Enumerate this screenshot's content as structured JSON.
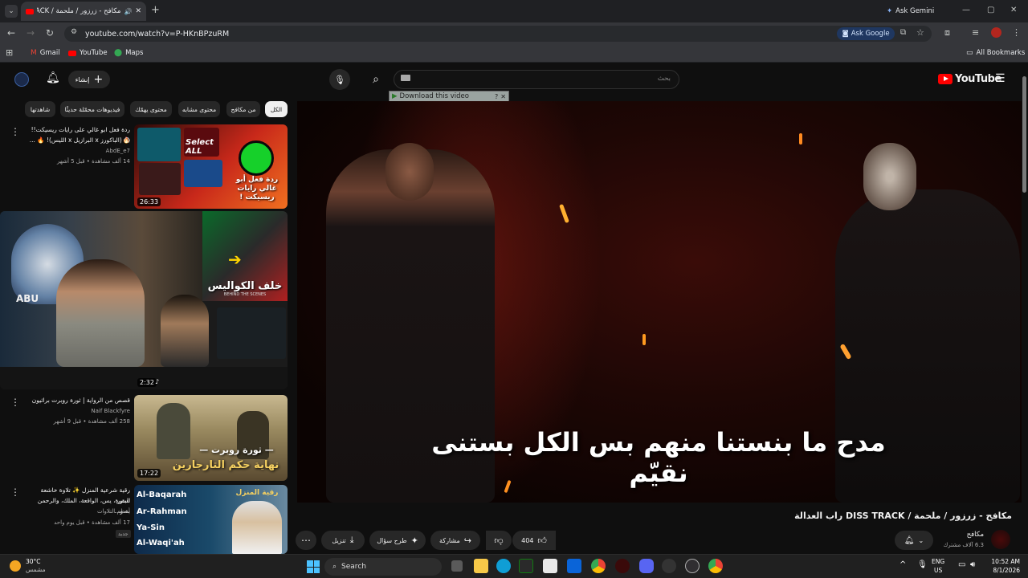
{
  "browser": {
    "tab_title": "مكافح - زرزور / ملحمة / DISS TRACK",
    "url": "youtube.com/watch?v=P-HKnBPzuRM",
    "ask_gemini": "Ask Gemini",
    "ask_google": "Ask Google",
    "bookmarks": [
      "Gmail",
      "YouTube",
      "Maps"
    ],
    "all_bookmarks": "All Bookmarks"
  },
  "youtube": {
    "logo_text": "YouTube",
    "search_placeholder": "بحث",
    "create_label": "إنشاء",
    "download_bar": "Download this video",
    "chips": [
      "الكل",
      "من مكافح",
      "محتوى مشابه",
      "محتوى يهمّك",
      "فيديوهات محمّلة حديثًا",
      "شاهدتها"
    ],
    "recommendations": [
      {
        "title_line1": "ردة فعل ابو غالي على رايات ريسيكت!! 🔥",
        "title_line2": "😱 (الباكورز x البرازيل x الليس)! 🔥 ...",
        "channel": "AbdE_e7",
        "meta": "14 ألف مشاهدة • قبل 5 أشهر",
        "duration": "26:33",
        "thumb_text": "ردة فعل أبو غالي رايات ريسيكت !",
        "select_text": "Select ALL"
      },
      {
        "duration": "2:32",
        "thumb_text": "خلف الكواليس",
        "thumb_sub": "BEHIND THE SCENES",
        "logo_text": "ABU"
      },
      {
        "title": "قصص من الرواية | ثورة روبرت براثيون",
        "channel": "Naif Blackfyre",
        "meta": "258 ألف مشاهدة • قبل 9 أشهر",
        "duration": "17:22",
        "thumb_text1": "— ثورة روبرت —",
        "thumb_text2": "نهاية حكم التارجارين"
      },
      {
        "title_line1": "رقية شرعية المنزل ✨ تلاوة خاشعة لسور",
        "title_line2": "البقرة، يس، الواقعة، الملك، والرحمن بصو...",
        "channel": "أعظم التلاوات",
        "meta": "17 ألف مشاهدة • قبل يوم واحد",
        "badge": "جديد",
        "thumb_names": [
          "Al-Baqarah",
          "Ar-Rahman",
          "Ya-Sin",
          "Al-Waqi'ah"
        ],
        "thumb_header": "رقية المنزل"
      }
    ],
    "subtitle": "مدح ما بنستنا منهم بس الكل بستنى نقيّم",
    "video_title": "مكافح - زرزور / ملحمة / DISS TRACK راب العدالة",
    "channel_name": "مكافح",
    "subscribers": "6.3 آلاف مشترك",
    "likes": "404",
    "share_label": "مشاركة",
    "ask_label": "طرح سؤال",
    "download_label": "تنزيل"
  },
  "taskbar": {
    "weather_temp": "30°C",
    "weather_desc": "مشمس",
    "search_label": "Search",
    "lang_line1": "ENG",
    "lang_line2": "US",
    "time": "10:52 AM",
    "date": "8/1/2026"
  }
}
